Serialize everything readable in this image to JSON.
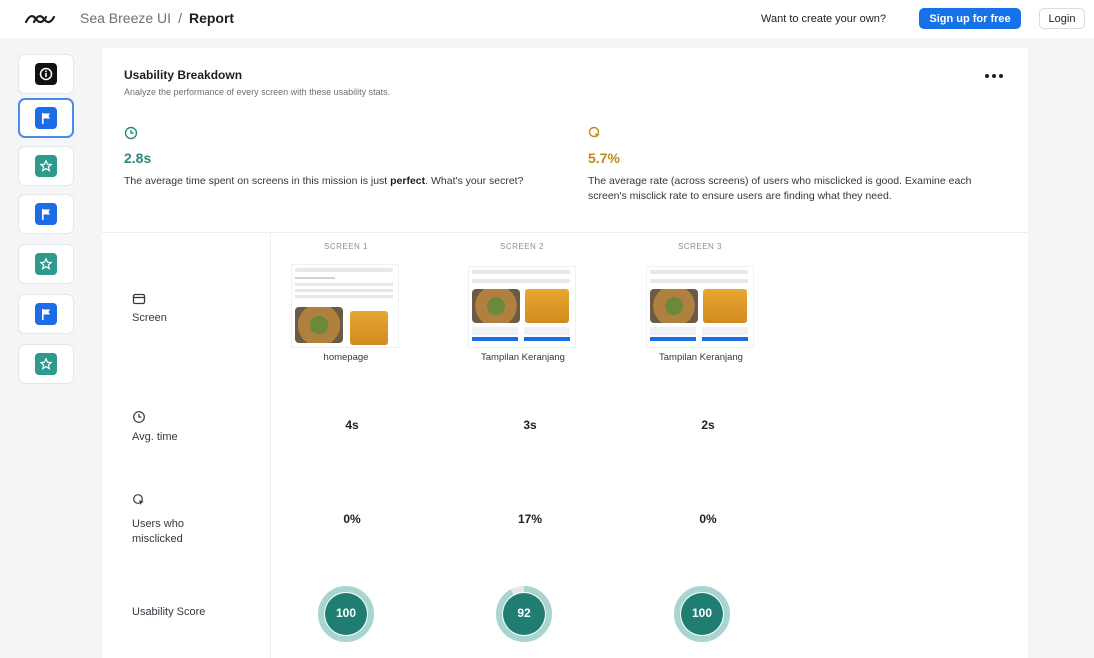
{
  "topbar": {
    "breadcrumb_root": "Sea Breeze UI",
    "breadcrumb_sep": "/",
    "breadcrumb_current": "Report",
    "cta_text": "Want to create your own?",
    "signup_label": "Sign up for free",
    "login_label": "Login",
    "logo_icon": "waves-logo-icon"
  },
  "sidebar": {
    "items": [
      {
        "icon": "info-icon",
        "color": "#111111",
        "active": false
      },
      {
        "icon": "flag-icon",
        "color": "#1a6de6",
        "active": true
      },
      {
        "icon": "star-icon",
        "color": "#2c9a8c",
        "active": false
      },
      {
        "icon": "flag-icon",
        "color": "#1a6de6",
        "active": false
      },
      {
        "icon": "star-icon",
        "color": "#2c9a8c",
        "active": false
      },
      {
        "icon": "flag-icon",
        "color": "#1a6de6",
        "active": false
      },
      {
        "icon": "star-icon",
        "color": "#2c9a8c",
        "active": false
      }
    ]
  },
  "card": {
    "title": "Usability Breakdown",
    "subtitle": "Analyze the performance of every screen with these usability stats."
  },
  "stats": {
    "time": {
      "value": "2.8s",
      "desc_prefix": "The average time spent on screens in this mission is just",
      "desc_strong": "perfect",
      "desc_suffix": ". What's your secret?",
      "color": "#2a8a7c"
    },
    "misclick": {
      "value": "5.7%",
      "desc": "The average rate (across screens) of users who misclicked is good. Examine each screen's misclick rate to ensure users are finding what they need.",
      "color": "#c08a1a"
    }
  },
  "rows": {
    "screen": "Screen",
    "avg_time": "Avg. time",
    "misclicked": "Users who misclicked",
    "usability": "Usability Score"
  },
  "screens": [
    {
      "header": "SCREEN 1",
      "name": "homepage",
      "avg_time": "4s",
      "misclick": "0%",
      "score": "100",
      "score_fraction": 1.0
    },
    {
      "header": "SCREEN 2",
      "name": "Tampilan Keranjang",
      "avg_time": "3s",
      "misclick": "17%",
      "score": "92",
      "score_fraction": 0.92
    },
    {
      "header": "SCREEN 3",
      "name": "Tampilan Keranjang",
      "avg_time": "2s",
      "misclick": "0%",
      "score": "100",
      "score_fraction": 1.0
    }
  ],
  "colors": {
    "accent_blue": "#1572e8",
    "score_teal": "#1f7d72",
    "score_ring": "#a8d5cf"
  }
}
